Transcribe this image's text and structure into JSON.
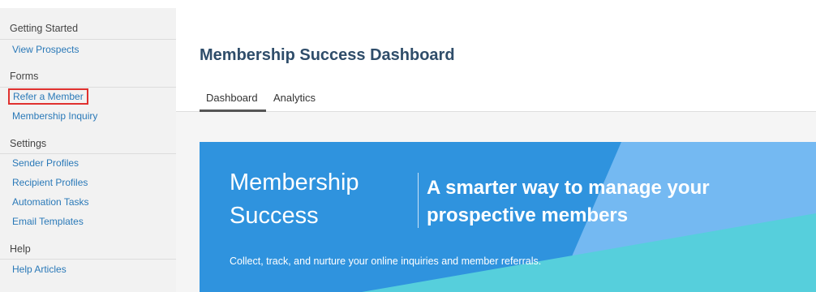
{
  "sidebar": {
    "sections": [
      {
        "title": "Getting Started",
        "items": [
          "View Prospects"
        ]
      },
      {
        "title": "Forms",
        "items": [
          "Refer a Member",
          "Membership Inquiry"
        ]
      },
      {
        "title": "Settings",
        "items": [
          "Sender Profiles",
          "Recipient Profiles",
          "Automation Tasks",
          "Email Templates"
        ]
      },
      {
        "title": "Help",
        "items": [
          "Help Articles"
        ]
      }
    ],
    "selected_item": "Refer a Member"
  },
  "main": {
    "title": "Membership Success Dashboard",
    "tabs": [
      {
        "label": "Dashboard",
        "active": true
      },
      {
        "label": "Analytics",
        "active": false
      }
    ],
    "banner": {
      "brand_line1": "Membership",
      "brand_line2": "Success",
      "tagline_line1": "A smarter way to manage your",
      "tagline_line2": "prospective members",
      "subtitle": "Collect, track, and nurture your online inquiries and member referrals."
    }
  },
  "colors": {
    "link": "#2a79b8",
    "highlight_border": "#e0312f",
    "banner_blue": "#2f93de",
    "banner_light_blue": "#74b9f2",
    "banner_teal": "#56cfdc"
  }
}
